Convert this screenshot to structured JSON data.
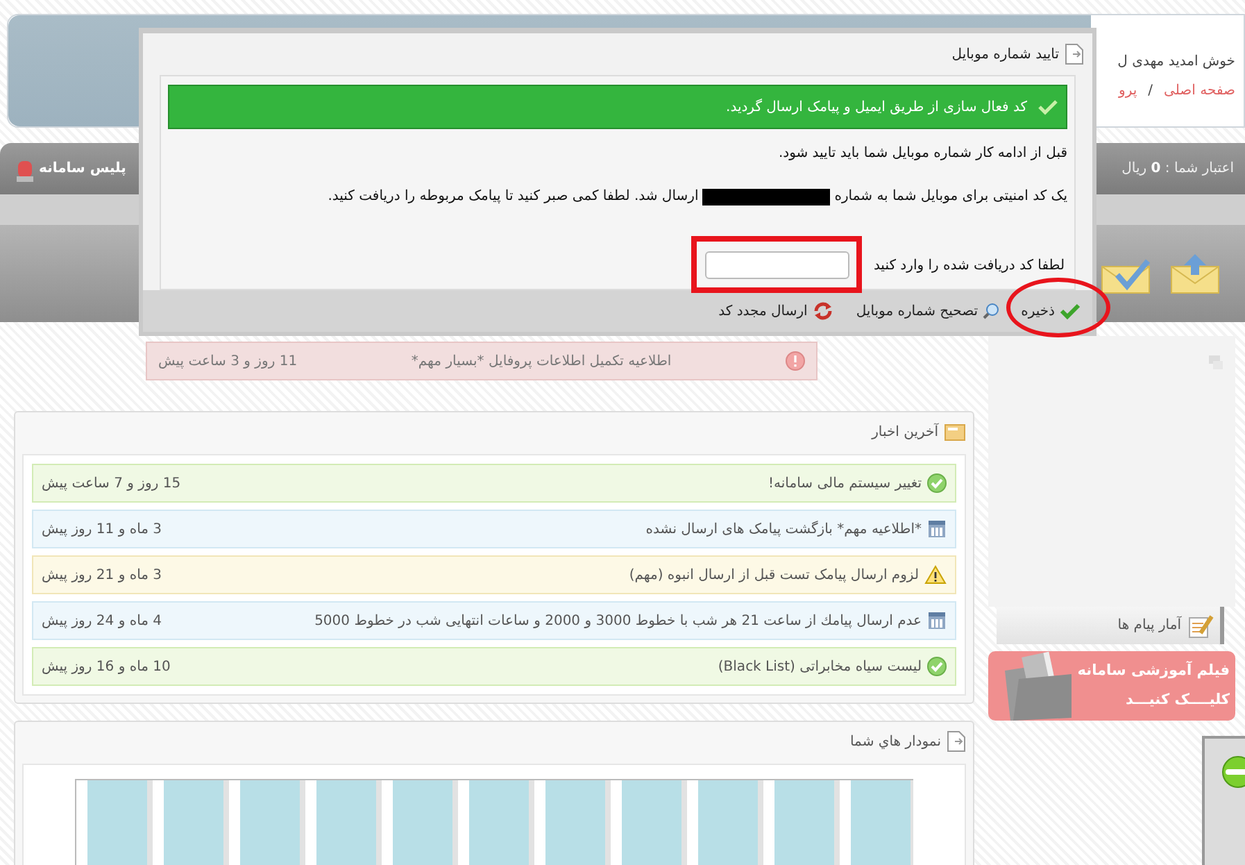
{
  "header": {
    "welcome": "خوش امدید مهدی ل",
    "breadcrumb": [
      "صفحه اصلی",
      "پرو"
    ],
    "breadcrumb_separator": "/"
  },
  "account_bar": {
    "credit": "اعتبار شما : **0** ریال",
    "police_link": "پلیس سامانه"
  },
  "alert": {
    "text": "اطلاعیه تکمیل اطلاعات پروفایل *بسیار مهم*",
    "time": "11 روز و 3 ساعت پیش"
  },
  "news": {
    "title": "آخرین اخبار",
    "items": [
      {
        "kind": "success",
        "text": "تغییر سیستم مالی سامانه!",
        "time": "15 روز و 7 ساعت پیش"
      },
      {
        "kind": "info",
        "text": "*اطلاعیه مهم* بازگشت پیامک های ارسال نشده",
        "time": "3 ماه و 11 روز پیش"
      },
      {
        "kind": "warning",
        "text": "لزوم ارسال پیامک تست قبل از ارسال انبوه (مهم)",
        "time": "3 ماه و 21 روز پیش"
      },
      {
        "kind": "info",
        "text": "عدم ارسال پیامك از ساعت 21 هر شب با خطوط 3000 و 2000 و ساعات انتهایی شب در خطوط 5000",
        "time": "4 ماه و 24 روز پیش"
      },
      {
        "kind": "success",
        "text": "لیست سیاه مخابراتی (Black List)",
        "time": "10 ماه و 16 روز پیش"
      }
    ]
  },
  "charts_panel": {
    "title": "نمودار هاي شما"
  },
  "sidebar": {
    "stats_title": "آمار پیام ها",
    "banner": [
      "فیلم آموزشی سامانه",
      "کلیــــک کنیـــد"
    ]
  },
  "dialog": {
    "title": "تایید شماره موبایل",
    "success_message": "کد فعال سازی از طریق ایمیل و پیامک ارسال گردید.",
    "intro": "قبل از ادامه کار شماره موبایل شما باید تایید شود.",
    "sms_before": "یک کد امنیتی برای موبایل شما به شماره",
    "phone_redacted": true,
    "sms_after": "ارسال شد. لطفا کمی صبر کنید تا پیامک مربوطه را دریافت کنید.",
    "code_label": "لطفا کد دریافت شده را وارد کنید",
    "buttons": [
      {
        "kind": "save",
        "label": "ذخیره"
      },
      {
        "kind": "edit",
        "label": "تصحیح شماره موبایل"
      },
      {
        "kind": "resend",
        "label": "ارسال مجدد کد"
      }
    ]
  },
  "annotations": [
    {
      "kind": "rectangle"
    },
    {
      "kind": "ellipse"
    }
  ]
}
